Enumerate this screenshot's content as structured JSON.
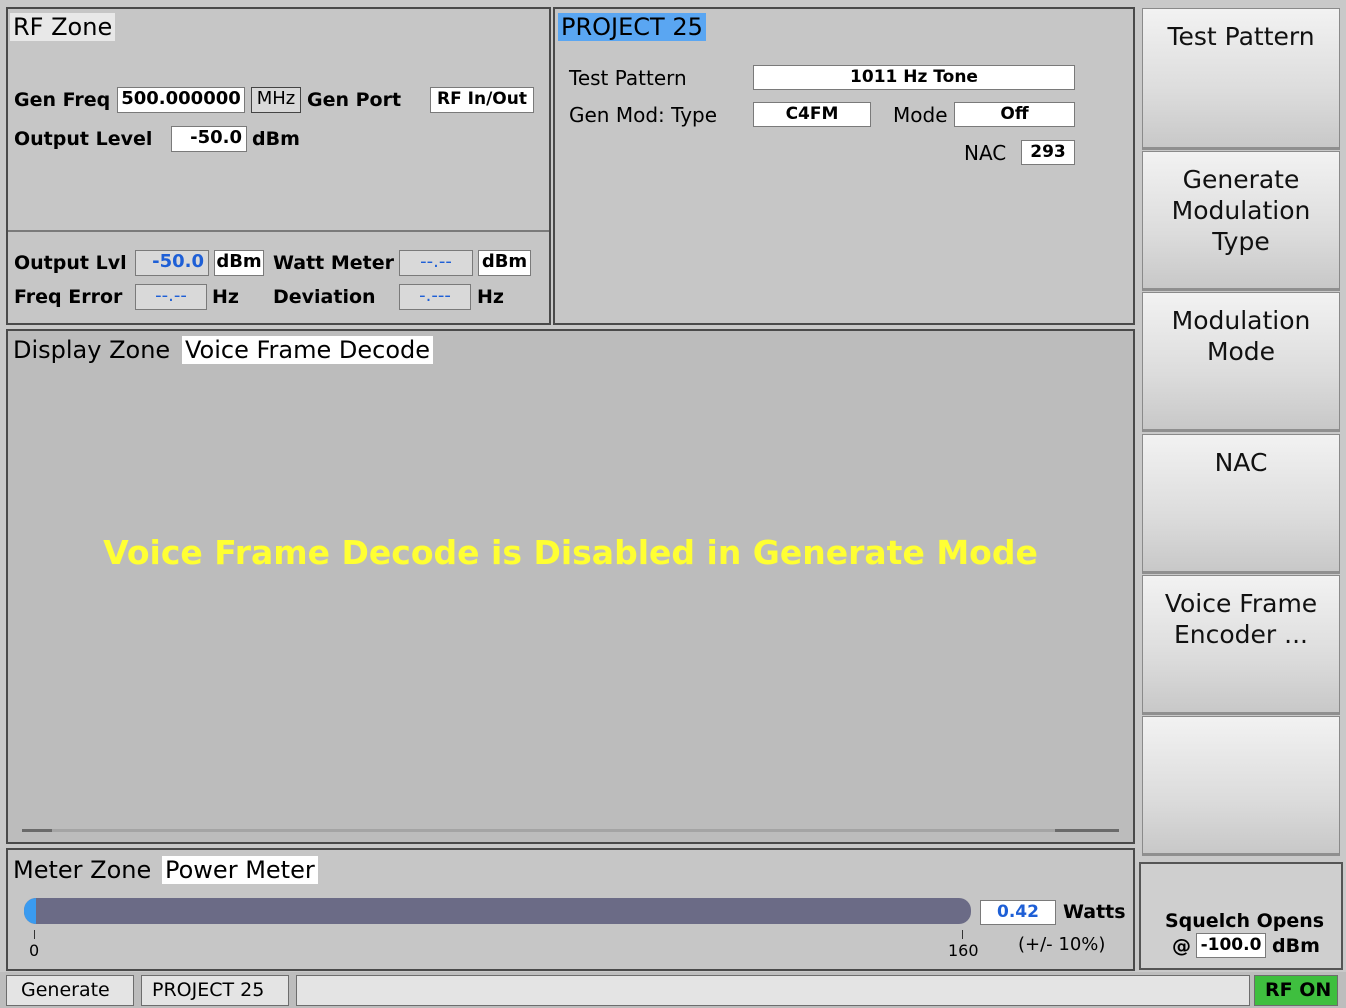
{
  "rf_zone": {
    "title": "RF Zone",
    "gen_freq_label": "Gen Freq",
    "gen_freq_value": "500.000000",
    "gen_freq_unit": "MHz",
    "gen_port_label": "Gen Port",
    "gen_port_value": "RF In/Out",
    "output_level_label": "Output Level",
    "output_level_value": "-50.0",
    "output_level_unit": "dBm",
    "output_lvl_label": "Output Lvl",
    "output_lvl_value": "-50.0",
    "output_lvl_unit": "dBm",
    "watt_meter_label": "Watt Meter",
    "watt_meter_value": "--.--",
    "watt_meter_unit": "dBm",
    "freq_error_label": "Freq Error",
    "freq_error_value": "--.--",
    "freq_error_unit": "Hz",
    "deviation_label": "Deviation",
    "deviation_value": "-.---",
    "deviation_unit": "Hz"
  },
  "p25": {
    "title": "PROJECT 25",
    "test_pattern_label": "Test Pattern",
    "test_pattern_value": "1011 Hz Tone",
    "gen_mod_type_label": "Gen Mod: Type",
    "gen_mod_type_value": "C4FM",
    "mode_label": "Mode",
    "mode_value": "Off",
    "nac_label": "NAC",
    "nac_value": "293"
  },
  "display_zone": {
    "title": "Display Zone",
    "tab": "Voice Frame Decode",
    "message": "Voice Frame Decode is Disabled in Generate Mode"
  },
  "meter_zone": {
    "title": "Meter Zone",
    "tab": "Power Meter",
    "value": "0.42",
    "unit": "Watts",
    "scale_min": "0",
    "scale_max": "160",
    "accuracy": "(+/- 10%)",
    "level_fraction": 0.003
  },
  "softkeys": {
    "k1_line1": "Test Pattern",
    "k2_line1": "Generate",
    "k2_line2": "Modulation",
    "k2_line3": "Type",
    "k3_line1": "Modulation",
    "k3_line2": "Mode",
    "k4_line1": "NAC",
    "k5_line1": "Voice Frame",
    "k5_line2": "Encoder ..."
  },
  "squelch": {
    "line1": "Squelch Opens",
    "at": "@",
    "value": "-100.0",
    "unit": "dBm"
  },
  "status_bar": {
    "mode": "Generate",
    "system": "PROJECT 25",
    "rf_status": "RF ON"
  },
  "colors": {
    "message_yellow": "#ffff33",
    "p25_title_blue": "#5aa6f2",
    "rf_on_green": "#3fbf3f",
    "meter_bar": "#6b6b86"
  }
}
